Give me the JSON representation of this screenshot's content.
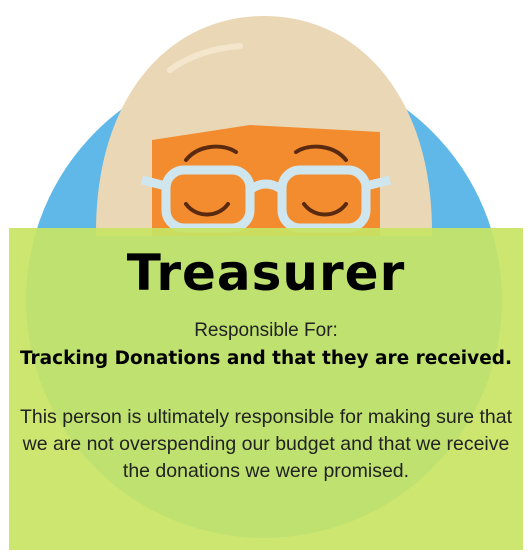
{
  "role": {
    "title": "Treasurer",
    "responsible_label": "Responsible For:",
    "responsibility": "Tracking Donations and that they are received.",
    "description": "This person is ultimately responsible for making sure that we are not overspending our budget and that we receive the donations we were promised."
  },
  "colors": {
    "circle": "#5fb8e8",
    "hair": "#ead7b5",
    "face": "#f28c2e",
    "glasses": "#cfe6ee",
    "card": "#c8e464"
  },
  "icons": {
    "avatar": "avatar-illustration"
  }
}
